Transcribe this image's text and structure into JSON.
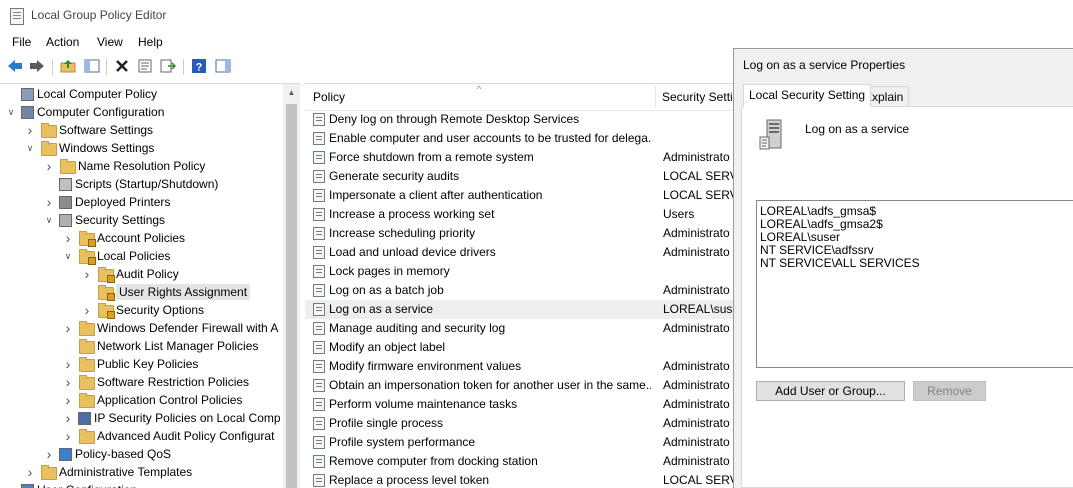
{
  "window": {
    "title": "Local Group Policy Editor"
  },
  "menu": [
    "File",
    "Action",
    "View",
    "Help"
  ],
  "toolbar_icons": [
    "back-arrow-icon",
    "forward-arrow-icon",
    "up-folder-icon",
    "show-hide-tree-icon",
    "delete-icon",
    "properties-icon",
    "export-list-icon",
    "help-icon",
    "show-hide-action-pane-icon"
  ],
  "tree": [
    {
      "label": "Local Computer Policy",
      "level": 0,
      "expander": "",
      "icon": "computer-policy"
    },
    {
      "label": "Computer Configuration",
      "level": 0,
      "expander": "open",
      "icon": "computer"
    },
    {
      "label": "Software Settings",
      "level": 1,
      "expander": "closed",
      "icon": "folder"
    },
    {
      "label": "Windows Settings",
      "level": 1,
      "expander": "open",
      "icon": "folder"
    },
    {
      "label": "Name Resolution Policy",
      "level": 2,
      "expander": "closed",
      "icon": "folder"
    },
    {
      "label": "Scripts (Startup/Shutdown)",
      "level": 2,
      "expander": "",
      "icon": "script"
    },
    {
      "label": "Deployed Printers",
      "level": 2,
      "expander": "closed",
      "icon": "printer"
    },
    {
      "label": "Security Settings",
      "level": 2,
      "expander": "open",
      "icon": "security"
    },
    {
      "label": "Account Policies",
      "level": 3,
      "expander": "closed",
      "icon": "lock-folder"
    },
    {
      "label": "Local Policies",
      "level": 3,
      "expander": "open",
      "icon": "lock-folder"
    },
    {
      "label": "Audit Policy",
      "level": 4,
      "expander": "closed",
      "icon": "lock-folder"
    },
    {
      "label": "User Rights Assignment",
      "level": 4,
      "expander": "",
      "icon": "lock-folder",
      "selected": true
    },
    {
      "label": "Security Options",
      "level": 4,
      "expander": "closed",
      "icon": "lock-folder"
    },
    {
      "label": "Windows Defender Firewall with A",
      "level": 3,
      "expander": "closed",
      "icon": "folder"
    },
    {
      "label": "Network List Manager Policies",
      "level": 3,
      "expander": "",
      "icon": "folder"
    },
    {
      "label": "Public Key Policies",
      "level": 3,
      "expander": "closed",
      "icon": "folder"
    },
    {
      "label": "Software Restriction Policies",
      "level": 3,
      "expander": "closed",
      "icon": "folder"
    },
    {
      "label": "Application Control Policies",
      "level": 3,
      "expander": "closed",
      "icon": "folder"
    },
    {
      "label": "IP Security Policies on Local Comp",
      "level": 3,
      "expander": "closed",
      "icon": "ipsec"
    },
    {
      "label": "Advanced Audit Policy Configurat",
      "level": 3,
      "expander": "closed",
      "icon": "folder"
    },
    {
      "label": "Policy-based QoS",
      "level": 2,
      "expander": "closed",
      "icon": "chart"
    },
    {
      "label": "Administrative Templates",
      "level": 1,
      "expander": "closed",
      "icon": "folder"
    },
    {
      "label": "User Configuration",
      "level": 0,
      "expander": "closed",
      "icon": "user"
    }
  ],
  "list": {
    "columns": [
      "Policy",
      "Security Setti"
    ],
    "rows": [
      {
        "policy": "Deny log on through Remote Desktop Services",
        "setting": ""
      },
      {
        "policy": "Enable computer and user accounts to be trusted for delega...",
        "setting": ""
      },
      {
        "policy": "Force shutdown from a remote system",
        "setting": "Administrato"
      },
      {
        "policy": "Generate security audits",
        "setting": "LOCAL SERVI"
      },
      {
        "policy": "Impersonate a client after authentication",
        "setting": "LOCAL SERVI"
      },
      {
        "policy": "Increase a process working set",
        "setting": "Users"
      },
      {
        "policy": "Increase scheduling priority",
        "setting": "Administrato"
      },
      {
        "policy": "Load and unload device drivers",
        "setting": "Administrato"
      },
      {
        "policy": "Lock pages in memory",
        "setting": ""
      },
      {
        "policy": "Log on as a batch job",
        "setting": "Administrato"
      },
      {
        "policy": "Log on as a service",
        "setting": "LOREAL\\suse",
        "selected": true
      },
      {
        "policy": "Manage auditing and security log",
        "setting": "Administrato"
      },
      {
        "policy": "Modify an object label",
        "setting": ""
      },
      {
        "policy": "Modify firmware environment values",
        "setting": "Administrato"
      },
      {
        "policy": "Obtain an impersonation token for another user in the same...",
        "setting": "Administrato"
      },
      {
        "policy": "Perform volume maintenance tasks",
        "setting": "Administrato"
      },
      {
        "policy": "Profile single process",
        "setting": "Administrato"
      },
      {
        "policy": "Profile system performance",
        "setting": "Administrato"
      },
      {
        "policy": "Remove computer from docking station",
        "setting": "Administrato"
      },
      {
        "policy": "Replace a process level token",
        "setting": "LOCAL SERVI"
      }
    ]
  },
  "dialog": {
    "title": "Log on as a service Properties",
    "tabs": [
      "Local Security Setting",
      "Explain"
    ],
    "heading": "Log on as a service",
    "members": [
      "LOREAL\\adfs_gmsa$",
      "LOREAL\\adfs_gmsa2$",
      "LOREAL\\suser",
      "NT SERVICE\\adfssrv",
      "NT SERVICE\\ALL SERVICES"
    ],
    "add_button": "Add User or Group...",
    "remove_button": "Remove"
  }
}
